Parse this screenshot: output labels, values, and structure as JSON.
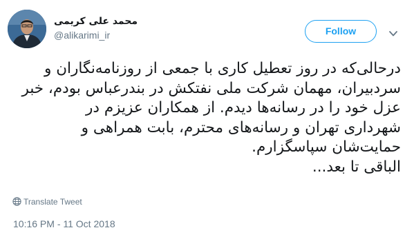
{
  "user": {
    "display_name": "محمد علی کریمی",
    "screen_name": "@alikarimi_ir",
    "avatar": "profile-photo"
  },
  "actions": {
    "follow_label": "Follow",
    "more_icon": "chevron-down-icon"
  },
  "tweet": {
    "lines": [
      "درحالی‌که در روز تعطیل کاری با جمعی از روزنامه‌نگاران و",
      "سردبیران، مهمان شرکت ملی نفتکش در بندرعباس بودم، خبر",
      "عزل خود را در رسانه‌ها دیدم. از همکاران عزیزم در",
      "شهرداری تهران و رسانه‌های محترم، بابت همراهی و",
      "حمایت‌شان سپاسگزارم.",
      "الباقی تا بعد..."
    ]
  },
  "translate": {
    "label": "Translate Tweet",
    "icon": "globe-icon"
  },
  "meta": {
    "timestamp": "10:16 PM - 11 Oct 2018"
  },
  "colors": {
    "accent": "#1da1f2",
    "text": "#14171a",
    "secondary": "#657786"
  }
}
